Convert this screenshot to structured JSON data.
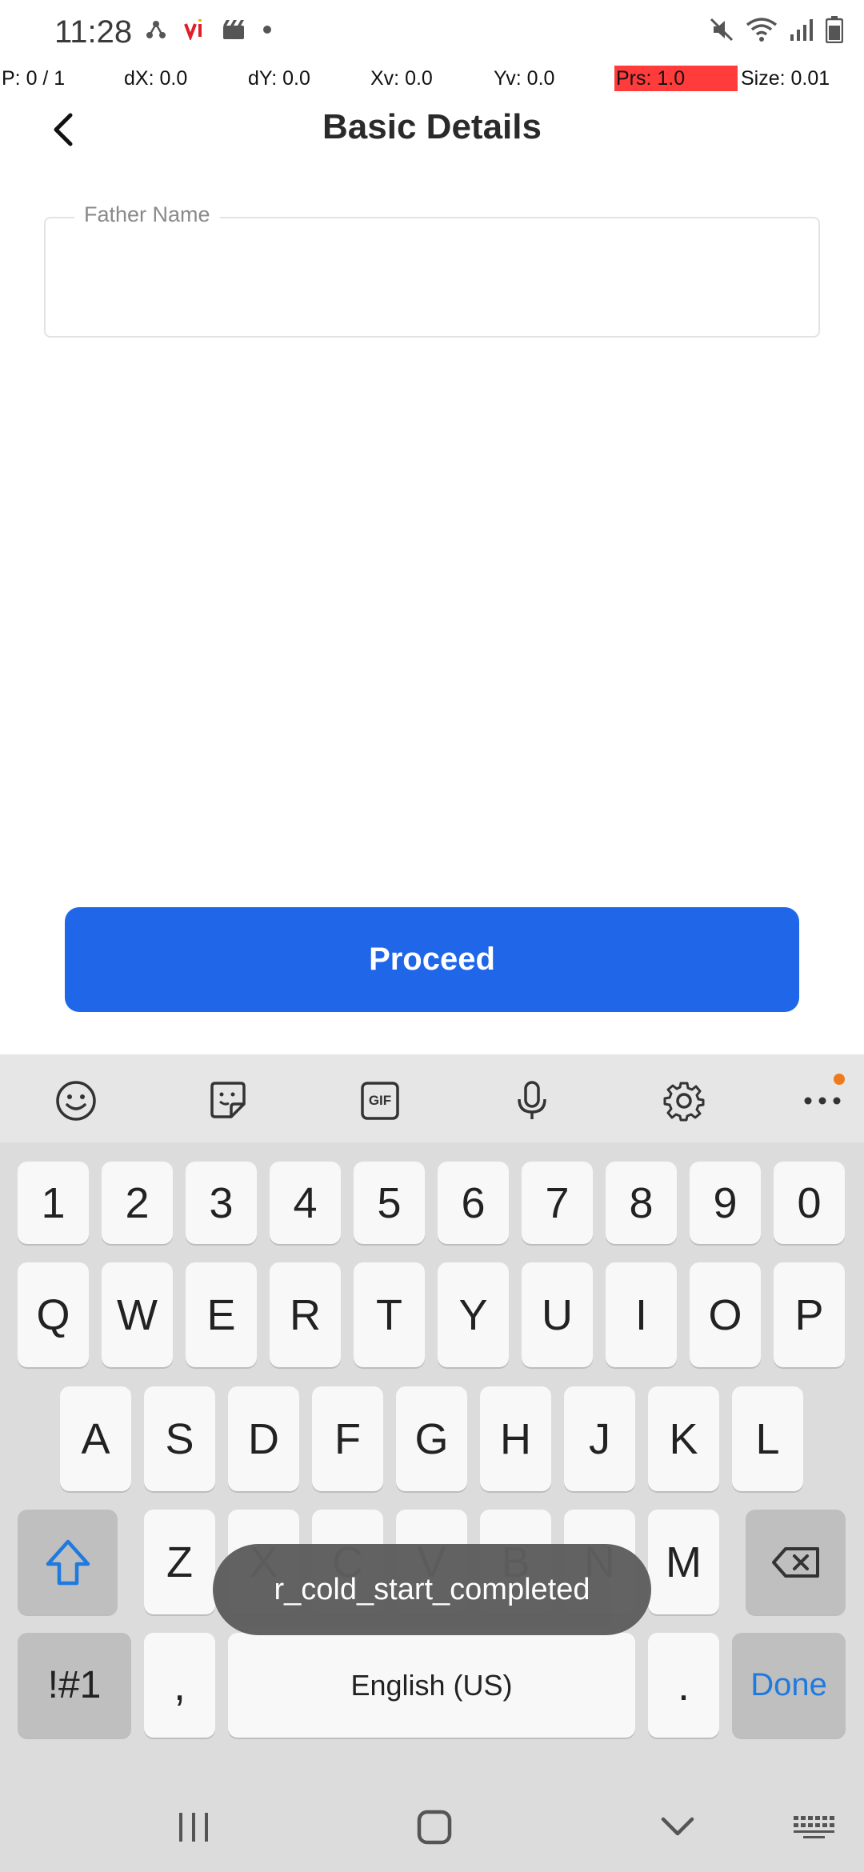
{
  "status_bar": {
    "time": "11:28",
    "left_icons": [
      "share-network-icon",
      "vi-app-icon",
      "clapper-icon",
      "dot-icon"
    ],
    "right_icons": [
      "mute-icon",
      "wifi-icon",
      "signal-icon",
      "battery-icon"
    ]
  },
  "pointer_overlay": {
    "p": "P: 0 / 1",
    "dx": "dX: 0.0",
    "dy": "dY: 0.0",
    "xv": "Xv: 0.0",
    "yv": "Yv: 0.0",
    "prs": "Prs: 1.0",
    "size": "Size: 0.01"
  },
  "header": {
    "title": "Basic Details"
  },
  "form": {
    "father_name": {
      "label": "Father Name",
      "value": ""
    }
  },
  "proceed_label": "Proceed",
  "keyboard": {
    "toolbar": [
      "emoji-icon",
      "sticker-icon",
      "gif-icon",
      "microphone-icon",
      "settings-gear-icon",
      "more-icon"
    ],
    "gif_label": "GIF",
    "row_numbers": [
      "1",
      "2",
      "3",
      "4",
      "5",
      "6",
      "7",
      "8",
      "9",
      "0"
    ],
    "row_qwerty": [
      "Q",
      "W",
      "E",
      "R",
      "T",
      "Y",
      "U",
      "I",
      "O",
      "P"
    ],
    "row_asdf": [
      "A",
      "S",
      "D",
      "F",
      "G",
      "H",
      "J",
      "K",
      "L"
    ],
    "row_zxcv": [
      "Z",
      "X",
      "C",
      "V",
      "B",
      "N",
      "M"
    ],
    "symbols_label": "!#1",
    "comma_label": ",",
    "space_label": "English (US)",
    "period_label": ".",
    "done_label": "Done",
    "accent_color": "#1f7ae0"
  },
  "toast": "r_cold_start_completed",
  "nav_bar": [
    "recents-icon",
    "home-icon",
    "back-down-icon",
    "keyboard-switch-icon"
  ]
}
